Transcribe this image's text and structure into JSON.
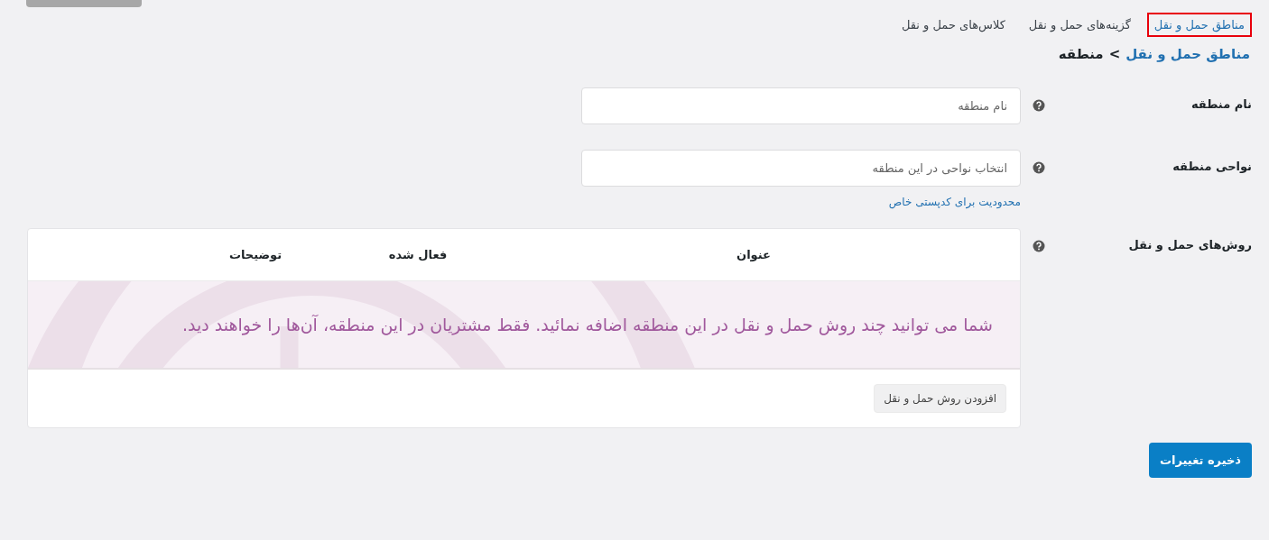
{
  "tabs": [
    {
      "label": "مناطق حمل و نقل",
      "selected": true
    },
    {
      "label": "گزینه‌های حمل و نقل",
      "selected": false
    },
    {
      "label": "کلاس‌های حمل و نقل",
      "selected": false
    }
  ],
  "breadcrumb": {
    "link": "مناطق حمل و نقل",
    "separator": ">",
    "current": "منطقه"
  },
  "fields": [
    {
      "label": "نام منطقه",
      "placeholder": "نام منطقه"
    },
    {
      "label": "نواحی منطقه",
      "placeholder": "انتخاب نواحی در این منطقه",
      "link": "محدودیت برای کدپستی خاص"
    }
  ],
  "methods": {
    "label": "روش‌های حمل و نقل",
    "columns": [
      "عنوان",
      "فعال شده",
      "توضیحات"
    ],
    "empty_message": "شما می توانید چند روش حمل و نقل در این منطقه اضافه نمائید. فقط مشتریان در این منطقه، آن‌ها را خواهند دید.",
    "add_button": "افزودن روش حمل و نقل"
  },
  "save_button": "ذخیره تغییرات"
}
